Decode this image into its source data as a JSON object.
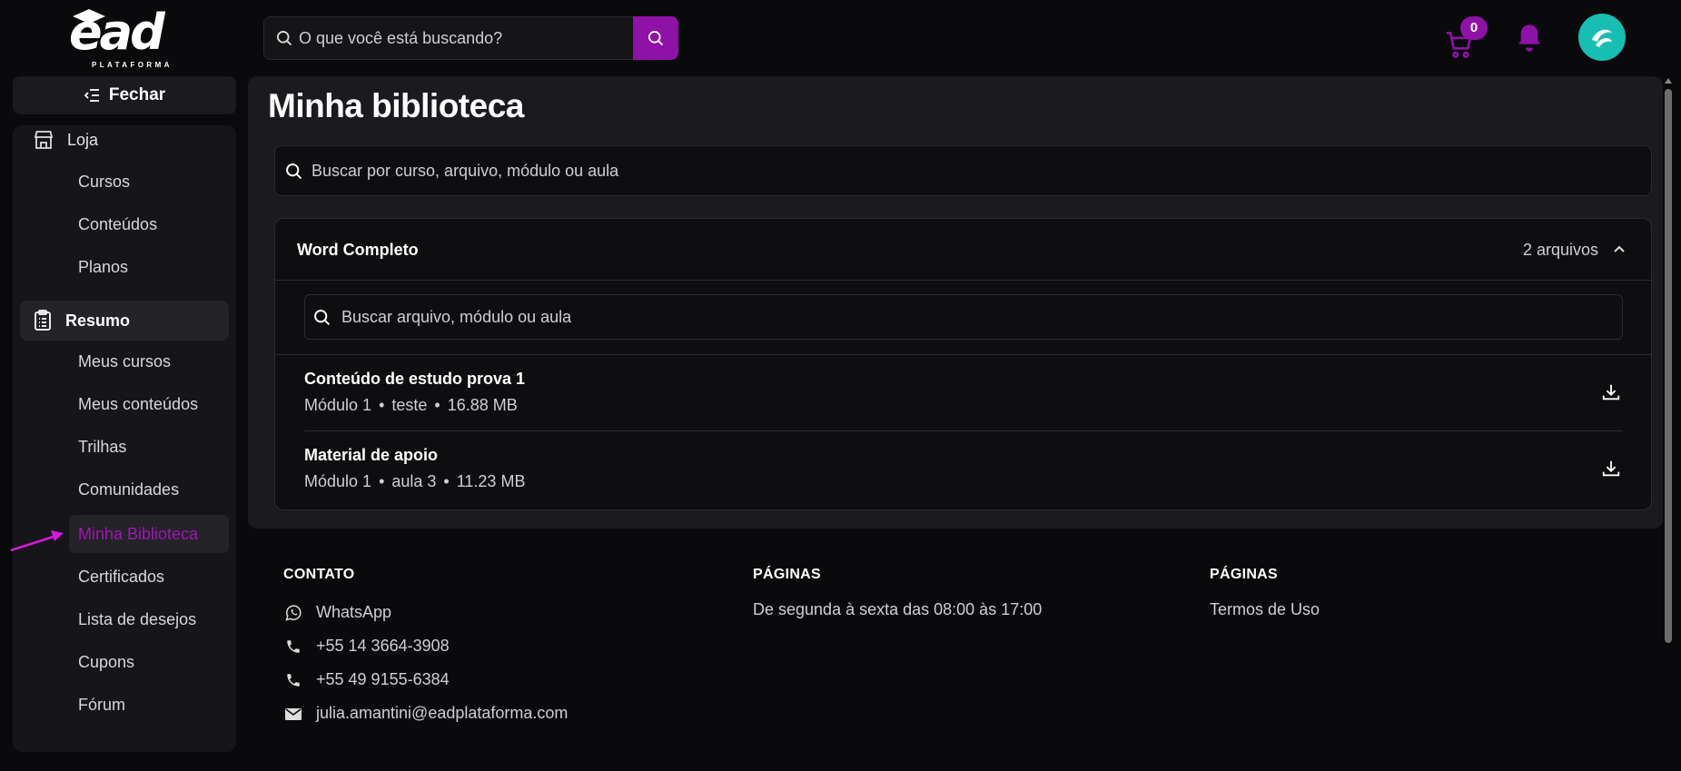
{
  "header": {
    "logo_text": "ead",
    "logo_sub": "PLATAFORMA",
    "search_placeholder": "O que você está buscando?",
    "cart_count": "0",
    "accent_color": "#8f12a8"
  },
  "sidebar": {
    "close_label": "Fechar",
    "loja_label": "Loja",
    "loja_items": [
      "Cursos",
      "Conteúdos",
      "Planos"
    ],
    "resumo_label": "Resumo",
    "resumo_items": [
      "Meus cursos",
      "Meus conteúdos",
      "Trilhas",
      "Comunidades",
      "Minha Biblioteca",
      "Certificados",
      "Lista de desejos",
      "Cupons",
      "Fórum"
    ],
    "selected_item": "Minha Biblioteca"
  },
  "main": {
    "title": "Minha biblioteca",
    "search_placeholder": "Buscar por curso, arquivo, módulo ou aula",
    "course": {
      "title": "Word Completo",
      "file_count": "2 arquivos",
      "search_placeholder": "Buscar arquivo, módulo ou aula",
      "files": [
        {
          "name": "Conteúdo de estudo prova 1",
          "module": "Módulo 1",
          "lesson": "teste",
          "size": "16.88 MB"
        },
        {
          "name": "Material de apoio",
          "module": "Módulo 1",
          "lesson": "aula 3",
          "size": "11.23 MB"
        }
      ]
    }
  },
  "footer": {
    "contato": {
      "heading": "CONTATO",
      "whatsapp": "WhatsApp",
      "phone1": "+55 14 3664-3908",
      "phone2": "+55 49 9155-6384",
      "email": "julia.amantini@eadplataforma.com"
    },
    "paginas1": {
      "heading": "PÁGINAS",
      "text": "De segunda à sexta das 08:00 às 17:00"
    },
    "paginas2": {
      "heading": "PÁGINAS",
      "link": "Termos de Uso"
    }
  }
}
